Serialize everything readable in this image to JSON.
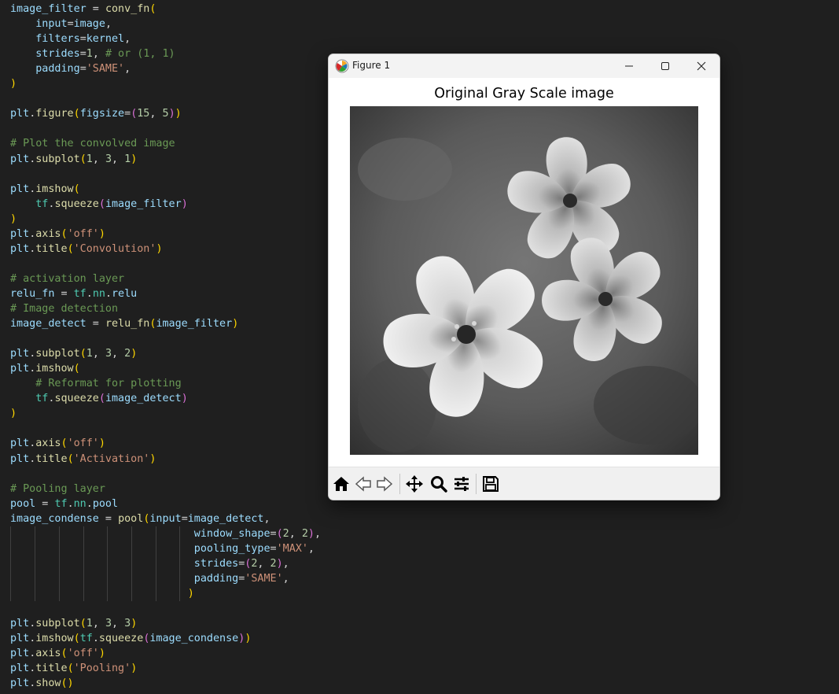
{
  "editor": {
    "lines": [
      [
        [
          "v",
          "image_filter"
        ],
        [
          "o",
          " = "
        ],
        [
          "f",
          "conv_fn"
        ],
        [
          "b1",
          "("
        ]
      ],
      [
        [
          "o",
          "    "
        ],
        [
          "v",
          "input"
        ],
        [
          "o",
          "="
        ],
        [
          "v",
          "image"
        ],
        [
          "o",
          ","
        ]
      ],
      [
        [
          "o",
          "    "
        ],
        [
          "v",
          "filters"
        ],
        [
          "o",
          "="
        ],
        [
          "v",
          "kernel"
        ],
        [
          "o",
          ","
        ]
      ],
      [
        [
          "o",
          "    "
        ],
        [
          "v",
          "strides"
        ],
        [
          "o",
          "="
        ],
        [
          "n",
          "1"
        ],
        [
          "o",
          ", "
        ],
        [
          "c",
          "# or (1, 1)"
        ]
      ],
      [
        [
          "o",
          "    "
        ],
        [
          "v",
          "padding"
        ],
        [
          "o",
          "="
        ],
        [
          "s",
          "'SAME'"
        ],
        [
          "o",
          ","
        ]
      ],
      [
        [
          "b1",
          ")"
        ]
      ],
      [],
      [
        [
          "v",
          "plt"
        ],
        [
          "o",
          "."
        ],
        [
          "f",
          "figure"
        ],
        [
          "b1",
          "("
        ],
        [
          "v",
          "figsize"
        ],
        [
          "o",
          "="
        ],
        [
          "b2",
          "("
        ],
        [
          "n",
          "15"
        ],
        [
          "o",
          ", "
        ],
        [
          "n",
          "5"
        ],
        [
          "b2",
          ")"
        ],
        [
          "b1",
          ")"
        ]
      ],
      [],
      [
        [
          "c",
          "# Plot the convolved image"
        ]
      ],
      [
        [
          "v",
          "plt"
        ],
        [
          "o",
          "."
        ],
        [
          "f",
          "subplot"
        ],
        [
          "b1",
          "("
        ],
        [
          "n",
          "1"
        ],
        [
          "o",
          ", "
        ],
        [
          "n",
          "3"
        ],
        [
          "o",
          ", "
        ],
        [
          "n",
          "1"
        ],
        [
          "b1",
          ")"
        ]
      ],
      [],
      [
        [
          "v",
          "plt"
        ],
        [
          "o",
          "."
        ],
        [
          "f",
          "imshow"
        ],
        [
          "b1",
          "("
        ]
      ],
      [
        [
          "o",
          "    "
        ],
        [
          "m",
          "tf"
        ],
        [
          "o",
          "."
        ],
        [
          "f",
          "squeeze"
        ],
        [
          "b2",
          "("
        ],
        [
          "v",
          "image_filter"
        ],
        [
          "b2",
          ")"
        ]
      ],
      [
        [
          "b1",
          ")"
        ]
      ],
      [
        [
          "v",
          "plt"
        ],
        [
          "o",
          "."
        ],
        [
          "f",
          "axis"
        ],
        [
          "b1",
          "("
        ],
        [
          "s",
          "'off'"
        ],
        [
          "b1",
          ")"
        ]
      ],
      [
        [
          "v",
          "plt"
        ],
        [
          "o",
          "."
        ],
        [
          "f",
          "title"
        ],
        [
          "b1",
          "("
        ],
        [
          "s",
          "'Convolution'"
        ],
        [
          "b1",
          ")"
        ]
      ],
      [],
      [
        [
          "c",
          "# activation layer"
        ]
      ],
      [
        [
          "v",
          "relu_fn"
        ],
        [
          "o",
          " = "
        ],
        [
          "m",
          "tf"
        ],
        [
          "o",
          "."
        ],
        [
          "m",
          "nn"
        ],
        [
          "o",
          "."
        ],
        [
          "v",
          "relu"
        ]
      ],
      [
        [
          "c",
          "# Image detection"
        ]
      ],
      [
        [
          "v",
          "image_detect"
        ],
        [
          "o",
          " = "
        ],
        [
          "f",
          "relu_fn"
        ],
        [
          "b1",
          "("
        ],
        [
          "v",
          "image_filter"
        ],
        [
          "b1",
          ")"
        ]
      ],
      [],
      [
        [
          "v",
          "plt"
        ],
        [
          "o",
          "."
        ],
        [
          "f",
          "subplot"
        ],
        [
          "b1",
          "("
        ],
        [
          "n",
          "1"
        ],
        [
          "o",
          ", "
        ],
        [
          "n",
          "3"
        ],
        [
          "o",
          ", "
        ],
        [
          "n",
          "2"
        ],
        [
          "b1",
          ")"
        ]
      ],
      [
        [
          "v",
          "plt"
        ],
        [
          "o",
          "."
        ],
        [
          "f",
          "imshow"
        ],
        [
          "b1",
          "("
        ]
      ],
      [
        [
          "o",
          "    "
        ],
        [
          "c",
          "# Reformat for plotting"
        ]
      ],
      [
        [
          "o",
          "    "
        ],
        [
          "m",
          "tf"
        ],
        [
          "o",
          "."
        ],
        [
          "f",
          "squeeze"
        ],
        [
          "b2",
          "("
        ],
        [
          "v",
          "image_detect"
        ],
        [
          "b2",
          ")"
        ]
      ],
      [
        [
          "b1",
          ")"
        ]
      ],
      [],
      [
        [
          "v",
          "plt"
        ],
        [
          "o",
          "."
        ],
        [
          "f",
          "axis"
        ],
        [
          "b1",
          "("
        ],
        [
          "s",
          "'off'"
        ],
        [
          "b1",
          ")"
        ]
      ],
      [
        [
          "v",
          "plt"
        ],
        [
          "o",
          "."
        ],
        [
          "f",
          "title"
        ],
        [
          "b1",
          "("
        ],
        [
          "s",
          "'Activation'"
        ],
        [
          "b1",
          ")"
        ]
      ],
      [],
      [
        [
          "c",
          "# Pooling layer"
        ]
      ],
      [
        [
          "v",
          "pool"
        ],
        [
          "o",
          " = "
        ],
        [
          "m",
          "tf"
        ],
        [
          "o",
          "."
        ],
        [
          "m",
          "nn"
        ],
        [
          "o",
          "."
        ],
        [
          "v",
          "pool"
        ]
      ],
      [
        [
          "v",
          "image_condense"
        ],
        [
          "o",
          " = "
        ],
        [
          "f",
          "pool"
        ],
        [
          "b1",
          "("
        ],
        [
          "v",
          "input"
        ],
        [
          "o",
          "="
        ],
        [
          "v",
          "image_detect"
        ],
        [
          "o",
          ","
        ]
      ],
      [
        [
          "o",
          "                             "
        ],
        [
          "v",
          "window_shape"
        ],
        [
          "o",
          "="
        ],
        [
          "b2",
          "("
        ],
        [
          "n",
          "2"
        ],
        [
          "o",
          ", "
        ],
        [
          "n",
          "2"
        ],
        [
          "b2",
          ")"
        ],
        [
          "o",
          ","
        ]
      ],
      [
        [
          "o",
          "                             "
        ],
        [
          "v",
          "pooling_type"
        ],
        [
          "o",
          "="
        ],
        [
          "s",
          "'MAX'"
        ],
        [
          "o",
          ","
        ]
      ],
      [
        [
          "o",
          "                             "
        ],
        [
          "v",
          "strides"
        ],
        [
          "o",
          "="
        ],
        [
          "b2",
          "("
        ],
        [
          "n",
          "2"
        ],
        [
          "o",
          ", "
        ],
        [
          "n",
          "2"
        ],
        [
          "b2",
          ")"
        ],
        [
          "o",
          ","
        ]
      ],
      [
        [
          "o",
          "                             "
        ],
        [
          "v",
          "padding"
        ],
        [
          "o",
          "="
        ],
        [
          "s",
          "'SAME'"
        ],
        [
          "o",
          ","
        ]
      ],
      [
        [
          "o",
          "                            "
        ],
        [
          "b1",
          ")"
        ]
      ],
      [],
      [
        [
          "v",
          "plt"
        ],
        [
          "o",
          "."
        ],
        [
          "f",
          "subplot"
        ],
        [
          "b1",
          "("
        ],
        [
          "n",
          "1"
        ],
        [
          "o",
          ", "
        ],
        [
          "n",
          "3"
        ],
        [
          "o",
          ", "
        ],
        [
          "n",
          "3"
        ],
        [
          "b1",
          ")"
        ]
      ],
      [
        [
          "v",
          "plt"
        ],
        [
          "o",
          "."
        ],
        [
          "f",
          "imshow"
        ],
        [
          "b1",
          "("
        ],
        [
          "m",
          "tf"
        ],
        [
          "o",
          "."
        ],
        [
          "f",
          "squeeze"
        ],
        [
          "b2",
          "("
        ],
        [
          "v",
          "image_condense"
        ],
        [
          "b2",
          ")"
        ],
        [
          "b1",
          ")"
        ]
      ],
      [
        [
          "v",
          "plt"
        ],
        [
          "o",
          "."
        ],
        [
          "f",
          "axis"
        ],
        [
          "b1",
          "("
        ],
        [
          "s",
          "'off'"
        ],
        [
          "b1",
          ")"
        ]
      ],
      [
        [
          "v",
          "plt"
        ],
        [
          "o",
          "."
        ],
        [
          "f",
          "title"
        ],
        [
          "b1",
          "("
        ],
        [
          "s",
          "'Pooling'"
        ],
        [
          "b1",
          ")"
        ]
      ],
      [
        [
          "v",
          "plt"
        ],
        [
          "o",
          "."
        ],
        [
          "f",
          "show"
        ],
        [
          "b1",
          "()"
        ]
      ]
    ]
  },
  "figure_window": {
    "title": "Figure 1",
    "plot_title": "Original Gray Scale image",
    "icons": {
      "app": "matplotlib-icon",
      "minimize": "minimize-icon",
      "maximize": "maximize-icon",
      "close": "close-icon"
    },
    "toolbar": [
      "home-icon",
      "back-arrow-icon",
      "forward-arrow-icon",
      "pan-icon",
      "zoom-icon",
      "configure-subplots-icon",
      "save-icon"
    ]
  }
}
